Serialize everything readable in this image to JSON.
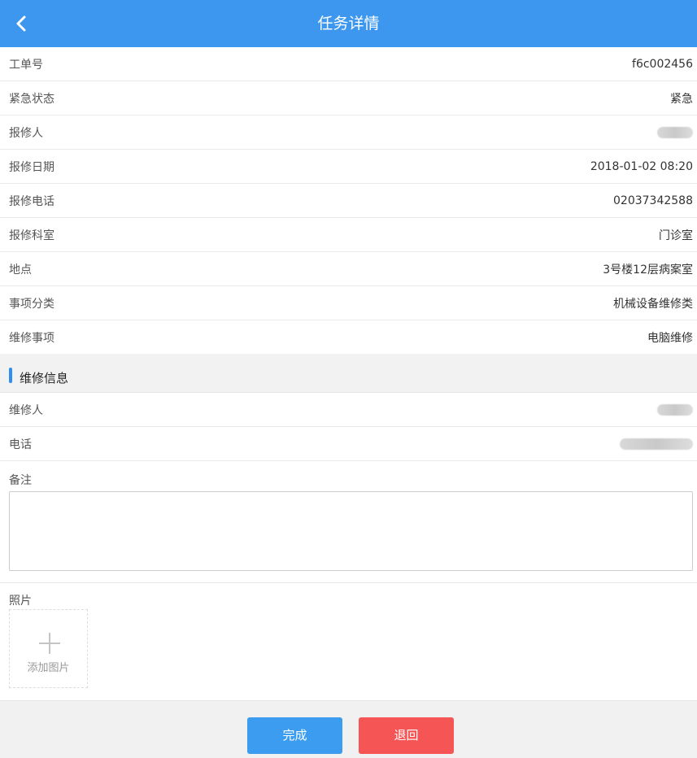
{
  "header": {
    "title": "任务详情",
    "back_icon": "chevron-left-icon"
  },
  "info_rows": [
    {
      "label": "工单号",
      "value": "f6c002456"
    },
    {
      "label": "紧急状态",
      "value": "紧急"
    },
    {
      "label": "报修人",
      "value": ""
    },
    {
      "label": "报修日期",
      "value": "2018-01-02 08:20"
    },
    {
      "label": "报修电话",
      "value": "02037342588"
    },
    {
      "label": "报修科室",
      "value": "门诊室"
    },
    {
      "label": "地点",
      "value": "3号楼12层病案室"
    },
    {
      "label": "事项分类",
      "value": "机械设备维修类"
    },
    {
      "label": "维修事项",
      "value": "电脑维修"
    }
  ],
  "section": {
    "title": "维修信息"
  },
  "repair_rows": [
    {
      "label": "维修人",
      "value": ""
    },
    {
      "label": "电话",
      "value": ""
    }
  ],
  "remark": {
    "label": "备注",
    "value": ""
  },
  "photos": {
    "label": "照片",
    "add_label": "添加图片",
    "add_icon": "plus-icon"
  },
  "footer": {
    "done_label": "完成",
    "return_label": "退回"
  },
  "colors": {
    "header_bg": "#3d97ee",
    "accent": "#2f8ff0",
    "done_button": "#3c9df0",
    "return_button": "#f55555"
  }
}
